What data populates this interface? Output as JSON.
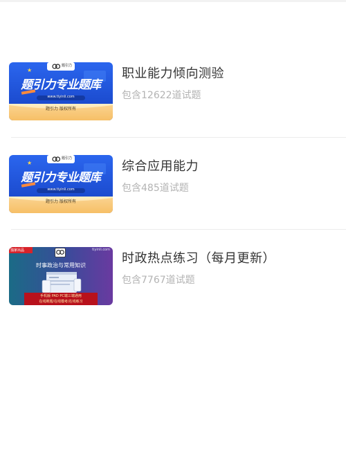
{
  "courses": [
    {
      "title": "职业能力倾向测验",
      "count_text": "包含12622道试题",
      "thumb": {
        "brand_icon": "owl-logo-icon",
        "brand_small": "题引力",
        "headline": "题引力专业题库",
        "url": "www.tiyinli.com",
        "footer": "题引力 版权所有"
      }
    },
    {
      "title": "综合应用能力",
      "count_text": "包含485道试题",
      "thumb": {
        "brand_icon": "owl-logo-icon",
        "brand_small": "题引力",
        "headline": "题引力专业题库",
        "url": "www.tiyinli.com",
        "footer": "题引力 版权所有"
      }
    },
    {
      "title": "时政热点练习（每月更新）",
      "count_text": "包含7767道试题",
      "thumb": {
        "brand_icon": "owl-logo-icon",
        "badge": "独家出品",
        "site": "tiyinli.com",
        "headline": "时事政治与常用知识",
        "banner_line1": "手机版   PAD   PC端三端通用",
        "banner_line2": "在线刷题/在线模考/在线练习"
      }
    }
  ],
  "colors": {
    "title": "#333333",
    "count": "#b3b3b3",
    "divider": "#ececec",
    "blue_bg": "#1a4fd6",
    "cream": "#fde2a8",
    "purple": "#5a3a9a",
    "teal": "#1a5f7a",
    "banner_red": "#c0101a"
  }
}
